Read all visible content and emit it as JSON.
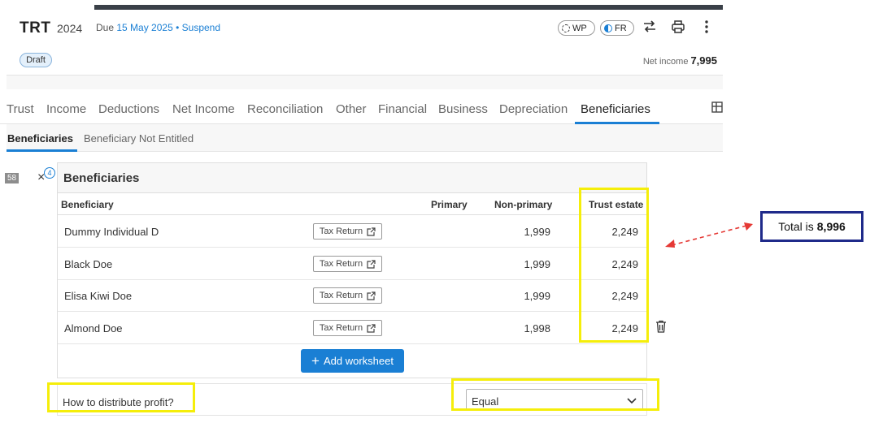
{
  "header": {
    "title": "TRT",
    "year": "2024",
    "due_label": "Due",
    "due_date": "15 May 2025",
    "bullet": "•",
    "suspend": "Suspend",
    "status_badge": "Draft",
    "net_income_label": "Net income",
    "net_income_value": "7,995",
    "pills": [
      {
        "label": "WP",
        "icon": "dashed-circle-icon"
      },
      {
        "label": "FR",
        "icon": "half-circle-icon"
      }
    ],
    "icons": [
      "swap-arrows-icon",
      "printer-icon",
      "kebab-menu-icon"
    ]
  },
  "main_tabs": [
    "Trust",
    "Income",
    "Deductions",
    "Net Income",
    "Reconciliation",
    "Other",
    "Financial",
    "Business",
    "Depreciation",
    "Beneficiaries"
  ],
  "active_main_tab": "Beneficiaries",
  "sub_tabs": [
    "Beneficiaries",
    "Beneficiary Not Entitled"
  ],
  "active_sub_tab": "Beneficiaries",
  "side": {
    "tag": "58",
    "close": "×",
    "badge": "4"
  },
  "panel": {
    "title": "Beneficiaries",
    "columns": [
      "Beneficiary",
      "Primary",
      "Non-primary",
      "Trust estate"
    ],
    "tax_return_label": "Tax Return",
    "rows": [
      {
        "name": "Dummy Individual D",
        "non_primary": "1,999",
        "trust_estate": "2,249"
      },
      {
        "name": "Black Doe",
        "non_primary": "1,999",
        "trust_estate": "2,249"
      },
      {
        "name": "Elisa Kiwi Doe",
        "non_primary": "1,999",
        "trust_estate": "2,249"
      },
      {
        "name": "Almond Doe",
        "non_primary": "1,998",
        "trust_estate": "2,249"
      }
    ],
    "add_button": "Add worksheet",
    "add_icon": "+"
  },
  "distribution": {
    "label": "How to distribute profit?",
    "value": "Equal"
  },
  "annotation": {
    "prefix": "Total is",
    "total": "8,996",
    "highlight_color": "#f5ee0a",
    "arrow_color": "#e53935",
    "box_color": "#1f2a8a"
  },
  "colors": {
    "accent": "#1a7fd4",
    "topbar": "#3a4048"
  }
}
